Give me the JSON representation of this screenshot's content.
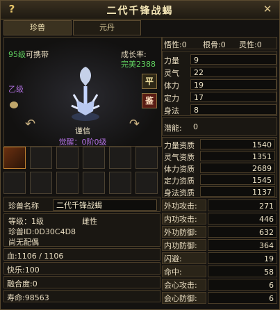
{
  "window": {
    "title": "二代千锋战蝎",
    "help": "?",
    "close": "✕"
  },
  "tabs": [
    {
      "label": "珍兽"
    },
    {
      "label": "元丹"
    }
  ],
  "pet": {
    "level_num": "95级",
    "level_suffix": "可携带",
    "growth_label": "成长率:",
    "growth_value": "完美2388",
    "grade": "乙级",
    "name_center": "谨信",
    "awaken": "觉醒：0阶0级",
    "badge_ping": "平",
    "badge_jian": "鉴"
  },
  "info": {
    "name_label": "珍兽名称",
    "name_value": "二代千锋战蝎",
    "level_line": "等级：1级",
    "gender": "雌性",
    "id_line": "珍兽ID:0D30C4D8",
    "mate": "尚无配偶",
    "hp": "血:1106 / 1106",
    "happy": "快乐:100",
    "fusion": "融合度:0",
    "life": "寿命:98563"
  },
  "top_stats": {
    "wuxing": "悟性:0",
    "genggu": "根骨:0",
    "lingxing": "灵性:0"
  },
  "attributes": [
    {
      "label": "力量",
      "value": "9"
    },
    {
      "label": "灵气",
      "value": "22"
    },
    {
      "label": "体力",
      "value": "19"
    },
    {
      "label": "定力",
      "value": "17"
    },
    {
      "label": "身法",
      "value": "8"
    }
  ],
  "potential": {
    "label": "潜能:",
    "value": "0"
  },
  "aptitudes": [
    {
      "label": "力量资质",
      "value": "1540"
    },
    {
      "label": "灵气资质",
      "value": "1351"
    },
    {
      "label": "体力资质",
      "value": "2689"
    },
    {
      "label": "定力资质",
      "value": "1545"
    },
    {
      "label": "身法资质",
      "value": "1137"
    }
  ],
  "combat": [
    {
      "label": "外功攻击:",
      "value": "271"
    },
    {
      "label": "内功攻击:",
      "value": "446"
    },
    {
      "label": "外功防御:",
      "value": "632"
    },
    {
      "label": "内功防御:",
      "value": "364"
    },
    {
      "label": "闪避:",
      "value": "19"
    },
    {
      "label": "命中:",
      "value": "58"
    },
    {
      "label": "会心攻击:",
      "value": "6"
    },
    {
      "label": "会心防御:",
      "value": "6"
    }
  ]
}
